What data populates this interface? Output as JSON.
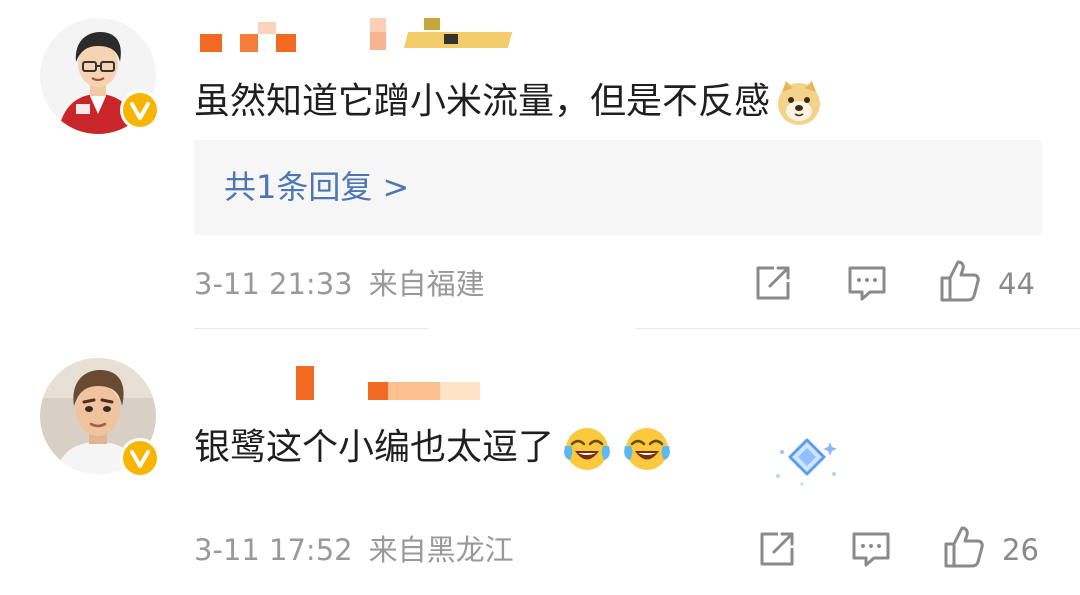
{
  "comments": [
    {
      "text": "虽然知道它蹭小米流量，但是不反感",
      "emoji": "doge-emoji",
      "reply_link": "共1条回复 >",
      "time": "3-11 21:33",
      "location": "来自福建",
      "likes": "44"
    },
    {
      "text": "银鹭这个小编也太逗了",
      "emoji": "laughing-crying-emoji",
      "time": "3-11 17:52",
      "location": "来自黑龙江",
      "likes": "26"
    }
  ],
  "colors": {
    "link": "#4d76b3",
    "meta": "#999999",
    "badge": "#f7b500",
    "reply_bg": "#f6f6f7",
    "mosaic_orange": "#f26a21"
  }
}
